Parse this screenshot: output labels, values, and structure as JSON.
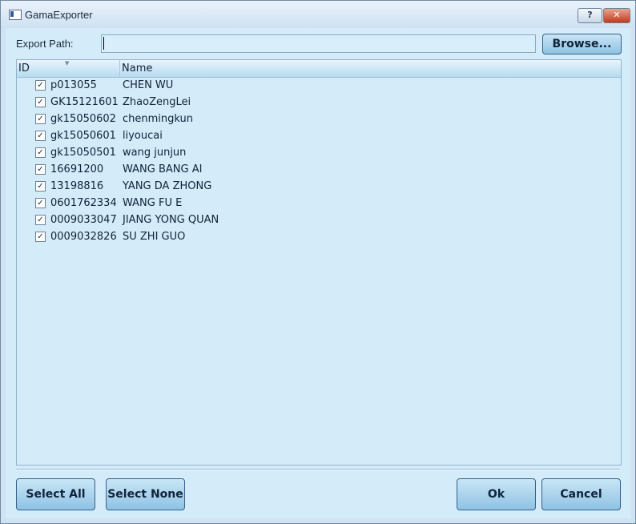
{
  "window": {
    "title": "GamaExporter",
    "help_label": "?",
    "close_label": "✕"
  },
  "export": {
    "label": "Export Path:",
    "value": "",
    "browse_label": "Browse..."
  },
  "table": {
    "columns": [
      "ID",
      "Name"
    ],
    "rows": [
      {
        "checked": true,
        "id": "p013055",
        "name": "CHEN WU"
      },
      {
        "checked": true,
        "id": "GK15121601",
        "name": "ZhaoZengLei"
      },
      {
        "checked": true,
        "id": "gk15050602",
        "name": "chenmingkun"
      },
      {
        "checked": true,
        "id": "gk15050601",
        "name": "liyoucai"
      },
      {
        "checked": true,
        "id": "gk15050501",
        "name": "wang junjun"
      },
      {
        "checked": true,
        "id": "16691200",
        "name": "WANG BANG AI"
      },
      {
        "checked": true,
        "id": "13198816",
        "name": "YANG DA ZHONG"
      },
      {
        "checked": true,
        "id": "0601762334",
        "name": "WANG FU E"
      },
      {
        "checked": true,
        "id": "0009033047",
        "name": "JIANG YONG QUAN"
      },
      {
        "checked": true,
        "id": "0009032826",
        "name": "SU ZHI GUO"
      }
    ]
  },
  "buttons": {
    "select_all": "Select All",
    "select_none": "Select None",
    "ok": "Ok",
    "cancel": "Cancel"
  }
}
